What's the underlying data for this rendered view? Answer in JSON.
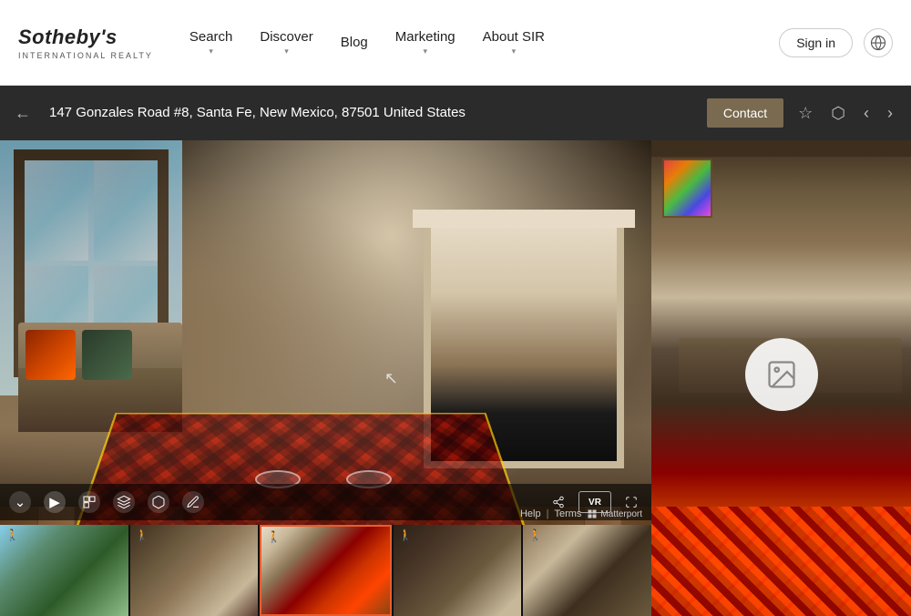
{
  "header": {
    "logo": {
      "name": "Sotheby's",
      "subtitle": "INTERNATIONAL REALTY"
    },
    "nav": [
      {
        "label": "Search",
        "has_dropdown": true
      },
      {
        "label": "Discover",
        "has_dropdown": true
      },
      {
        "label": "Blog",
        "has_dropdown": false
      },
      {
        "label": "Marketing",
        "has_dropdown": true
      },
      {
        "label": "About SIR",
        "has_dropdown": true
      }
    ],
    "sign_in": "Sign in",
    "globe_label": "Language selector"
  },
  "address_bar": {
    "address": "147 Gonzales Road #8, Santa Fe, New Mexico, 87501 United States",
    "contact_label": "Contact",
    "back_label": "←"
  },
  "tour": {
    "controls": {
      "expand_label": "⌄",
      "play_label": "▶",
      "floorplan_label": "⊞",
      "layers_label": "≡",
      "dollhouse_label": "⬛",
      "share_label": "⇪",
      "vr_label": "VR",
      "fullscreen_label": "⛶"
    },
    "thumbnails": [
      {
        "label": "thumb-1",
        "active": false,
        "icon": "🚶"
      },
      {
        "label": "thumb-2",
        "active": false,
        "icon": "🚶"
      },
      {
        "label": "thumb-3",
        "active": true,
        "icon": "🚶"
      },
      {
        "label": "thumb-4",
        "active": false,
        "icon": "🚶"
      },
      {
        "label": "thumb-5",
        "active": false,
        "icon": "🚶"
      }
    ],
    "footer": {
      "help": "Help",
      "separator": "|",
      "terms": "Terms",
      "matterport": "Matterport"
    }
  },
  "photo_panel": {
    "overlay_icon": "image"
  },
  "colors": {
    "contact_btn": "#7a6a50",
    "active_thumb_border": "#e85d2e",
    "address_bar_bg": "#2b2b2b",
    "header_bg": "#ffffff"
  }
}
